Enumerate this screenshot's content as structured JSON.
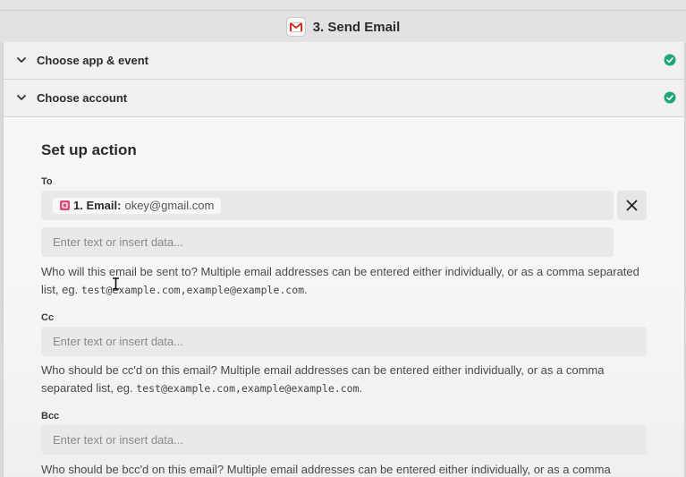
{
  "header": {
    "step_title": "3. Send Email",
    "app_icon": "gmail-icon"
  },
  "accordion": [
    {
      "label": "Choose app & event",
      "status": "complete"
    },
    {
      "label": "Choose account",
      "status": "complete"
    }
  ],
  "setup": {
    "title": "Set up action",
    "to": {
      "label": "To",
      "chip_key": "1. Email:",
      "chip_value": "okey@gmail.com",
      "placeholder": "Enter text or insert data...",
      "help_text": "Who will this email be sent to? Multiple email addresses can be entered either individually, or as a comma separated list, eg.",
      "help_example": "test@example.com,example@example.com",
      "help_end": "."
    },
    "cc": {
      "label": "Cc",
      "placeholder": "Enter text or insert data...",
      "help_text": "Who should be cc'd on this email? Multiple email addresses can be entered either individually, or as a comma separated list, eg.",
      "help_example": "test@example.com,example@example.com",
      "help_end": "."
    },
    "bcc": {
      "label": "Bcc",
      "placeholder": "Enter text or insert data...",
      "help_text": "Who should be bcc'd on this email? Multiple email addresses can be entered either individually, or as a comma separated"
    }
  },
  "colors": {
    "check_green": "#1fa67a",
    "chip_icon": "#d94d7a",
    "gmail_red": "#d93025"
  }
}
